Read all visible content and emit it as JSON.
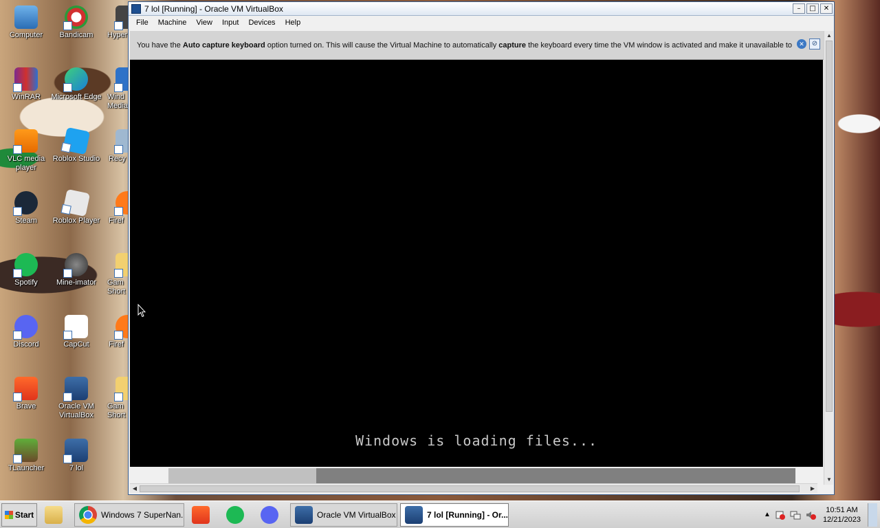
{
  "desktop": {
    "icons": [
      {
        "label": "Computer"
      },
      {
        "label": "Bandicam"
      },
      {
        "label": "Hyper"
      },
      {
        "label": "WinRAR"
      },
      {
        "label": "Microsoft Edge"
      },
      {
        "label": "Wind Media"
      },
      {
        "label": "VLC media player"
      },
      {
        "label": "Roblox Studio"
      },
      {
        "label": "Recy"
      },
      {
        "label": "Steam"
      },
      {
        "label": "Roblox Player"
      },
      {
        "label": "Firef"
      },
      {
        "label": "Spotify"
      },
      {
        "label": "Mine-imator"
      },
      {
        "label": "Gam Short"
      },
      {
        "label": "Discord"
      },
      {
        "label": "CapCut"
      },
      {
        "label": "Firef"
      },
      {
        "label": "Brave"
      },
      {
        "label": "Oracle VM VirtualBox"
      },
      {
        "label": "Gam Short"
      },
      {
        "label": "TLauncher"
      },
      {
        "label": "7 lol"
      }
    ]
  },
  "vbox": {
    "title": "7 lol [Running] - Oracle VM VirtualBox",
    "menu": [
      "File",
      "Machine",
      "View",
      "Input",
      "Devices",
      "Help"
    ],
    "notice": {
      "part1": "You have the ",
      "bold1": "Auto capture keyboard",
      "part2": " option turned on. This will cause the Virtual Machine to automatically ",
      "bold2": "capture",
      "part3": " the keyboard every time the VM window is activated and make it unavailable to"
    },
    "screen": {
      "loading_text": "Windows is loading files...",
      "progress_fraction": 0.236
    }
  },
  "taskbar": {
    "start_label": "Start",
    "items": [
      {
        "label": ""
      },
      {
        "label": "Windows 7 SuperNan..."
      },
      {
        "label": ""
      },
      {
        "label": ""
      },
      {
        "label": ""
      },
      {
        "label": "Oracle VM VirtualBox ..."
      },
      {
        "label": "7 lol [Running] - Or..."
      }
    ],
    "clock": {
      "time": "10:51 AM",
      "date": "12/21/2023"
    }
  },
  "colors": {
    "vm_background": "#000000",
    "progress_fill": "#c0c0c0",
    "progress_track": "#808080",
    "notice_bg": "#d4d4d4"
  }
}
